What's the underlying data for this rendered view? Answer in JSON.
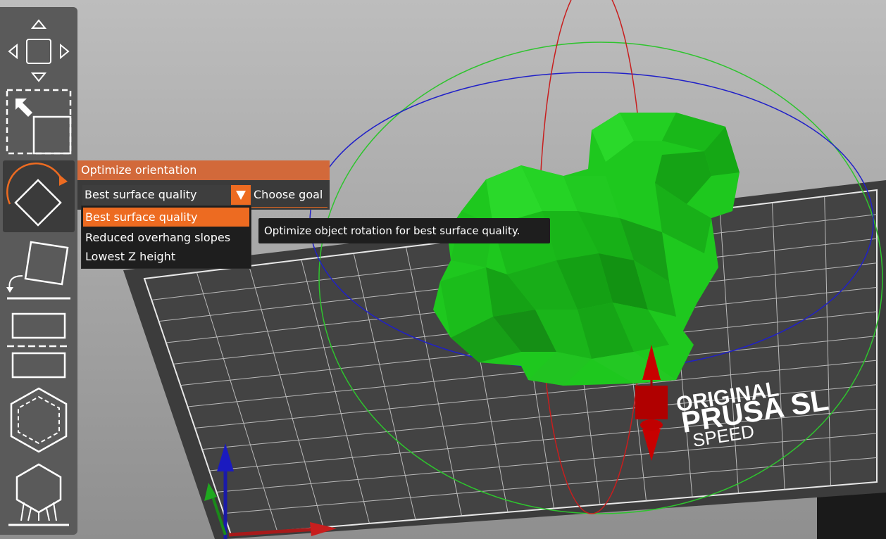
{
  "toolbar": {
    "tools": [
      {
        "name": "move",
        "icon": "move-arrows-icon"
      },
      {
        "name": "scale",
        "icon": "scale-icon"
      },
      {
        "name": "rotate",
        "icon": "rotate-icon",
        "active": true
      },
      {
        "name": "place-on-face",
        "icon": "place-on-face-icon"
      },
      {
        "name": "cut",
        "icon": "cut-icon"
      },
      {
        "name": "hollow",
        "icon": "hollow-icon"
      },
      {
        "name": "supports",
        "icon": "supports-icon"
      }
    ]
  },
  "orient_panel": {
    "title": "Optimize orientation",
    "selected_goal": "Best surface quality",
    "goal_label": "Choose goal",
    "options": [
      "Best surface quality",
      "Reduced overhang slopes",
      "Lowest Z height"
    ]
  },
  "tooltip": {
    "text": "Optimize object rotation for best surface quality."
  },
  "bed": {
    "logo_line1": "ORIGINAL",
    "logo_line2": "PRUSA SL",
    "logo_line3": "SPEED"
  },
  "colors": {
    "accent": "#ed6b21",
    "header": "#d2693a",
    "model": "#1ec81e",
    "gizmo_red": "#c80000",
    "gizmo_green": "#1fbf1f",
    "gizmo_blue": "#1f1fbf"
  }
}
